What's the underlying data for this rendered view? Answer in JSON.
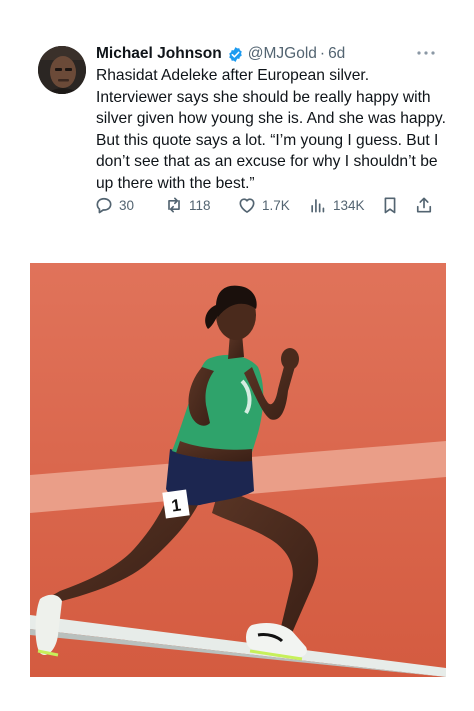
{
  "tweet": {
    "author_name": "Michael Johnson",
    "handle": "@MJGold",
    "separator": "·",
    "time": "6d",
    "text": "Rhasidat Adeleke after European silver. Interviewer says she should be really happy with silver given how young she is. And she was happy. But this quote says a lot. “I’m young I guess. But I don’t see that as an excuse for why I shouldn’t be up there with the best.”"
  },
  "actions": {
    "replies": "30",
    "reposts": "118",
    "likes": "1.7K",
    "views": "134K"
  },
  "media": {
    "bib_number": "1"
  },
  "icons": [
    "verified-badge-icon",
    "more-icon",
    "reply-icon",
    "repost-icon",
    "like-icon",
    "views-icon",
    "bookmark-icon",
    "share-icon"
  ],
  "colors": {
    "verified": "#1d9bf0",
    "secondary_text": "#536471",
    "track": "#d9654a",
    "singlet": "#2fa36b"
  }
}
